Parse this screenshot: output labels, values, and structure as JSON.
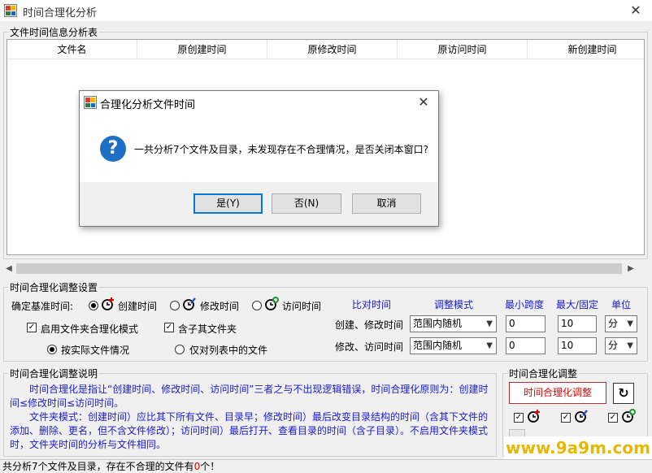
{
  "window": {
    "title": "时间合理化分析",
    "close_glyph": "✕"
  },
  "file_table": {
    "group_title": "文件时间信息分析表",
    "columns": [
      "文件名",
      "原创建时间",
      "原修改时间",
      "原访问时间",
      "新创建时间"
    ]
  },
  "settings": {
    "group_title": "时间合理化调整设置",
    "base_time_label": "确定基准时间:",
    "base_options": [
      {
        "label": "创建时间",
        "selected": true,
        "icon": "create-time-icon"
      },
      {
        "label": "修改时间",
        "selected": false,
        "icon": "modify-time-icon"
      },
      {
        "label": "访问时间",
        "selected": false,
        "icon": "access-time-icon"
      }
    ],
    "folder_mode_label": "启用文件夹合理化模式",
    "folder_mode_checked": true,
    "include_subfolders_label": "含子其文件夹",
    "include_subfolders_checked": true,
    "scope_options": [
      {
        "label": "按实际文件情况",
        "selected": true
      },
      {
        "label": "仅对列表中的文件",
        "selected": false
      }
    ],
    "headers": {
      "compare": "比对时间",
      "mode": "调整模式",
      "min_span": "最小跨度",
      "max_fixed": "最大/固定",
      "unit": "单位"
    },
    "rows": [
      {
        "compare": "创建、修改时间",
        "mode": "范围内随机",
        "min": "0",
        "max": "10",
        "unit": "分"
      },
      {
        "compare": "修改、访问时间",
        "mode": "范围内随机",
        "min": "0",
        "max": "10",
        "unit": "分"
      }
    ]
  },
  "description": {
    "group_title": "时间合理化调整说明",
    "paragraph1": "时间合理化是指让“创建时间、修改时间、访问时间”三者之与不出现逻辑错误，时间合理化原则为：创建时间≤修改时间≤访问时间。",
    "paragraph2": "文件夹模式：创建时间）应比其下所有文件、目录早；修改时间）最后改变目录结构的时间（含其下文件的添加、删除、更名，但不含文件修改）；访问时间）最后打开、查看目录的时间（含子目录）。不启用文件夹模式时，文件夹时间的分析与文件相同。"
  },
  "adjust_panel": {
    "group_title": "时间合理化调整",
    "button_label": "时间合理化调整",
    "refresh_glyph": "↻"
  },
  "status": {
    "prefix": "共分析7个文件及目录，存在不合理的文件有",
    "count": "0",
    "count_unit": "个",
    "suffix": "！",
    "count_color": "#e00000"
  },
  "dialog": {
    "title": "合理化分析文件时间",
    "close_glyph": "✕",
    "message": "一共分析7个文件及目录，未发现存在不合理情况，是否关闭本窗口?",
    "question_glyph": "?",
    "buttons": {
      "yes": "是(Y)",
      "no": "否(N)",
      "cancel": "取消"
    }
  },
  "watermark": "www.9a9m.com",
  "colors": {
    "accent_blue": "#1a1ad0",
    "adjust_red": "#d01010",
    "dialog_icon_blue": "#1f6fc5"
  }
}
